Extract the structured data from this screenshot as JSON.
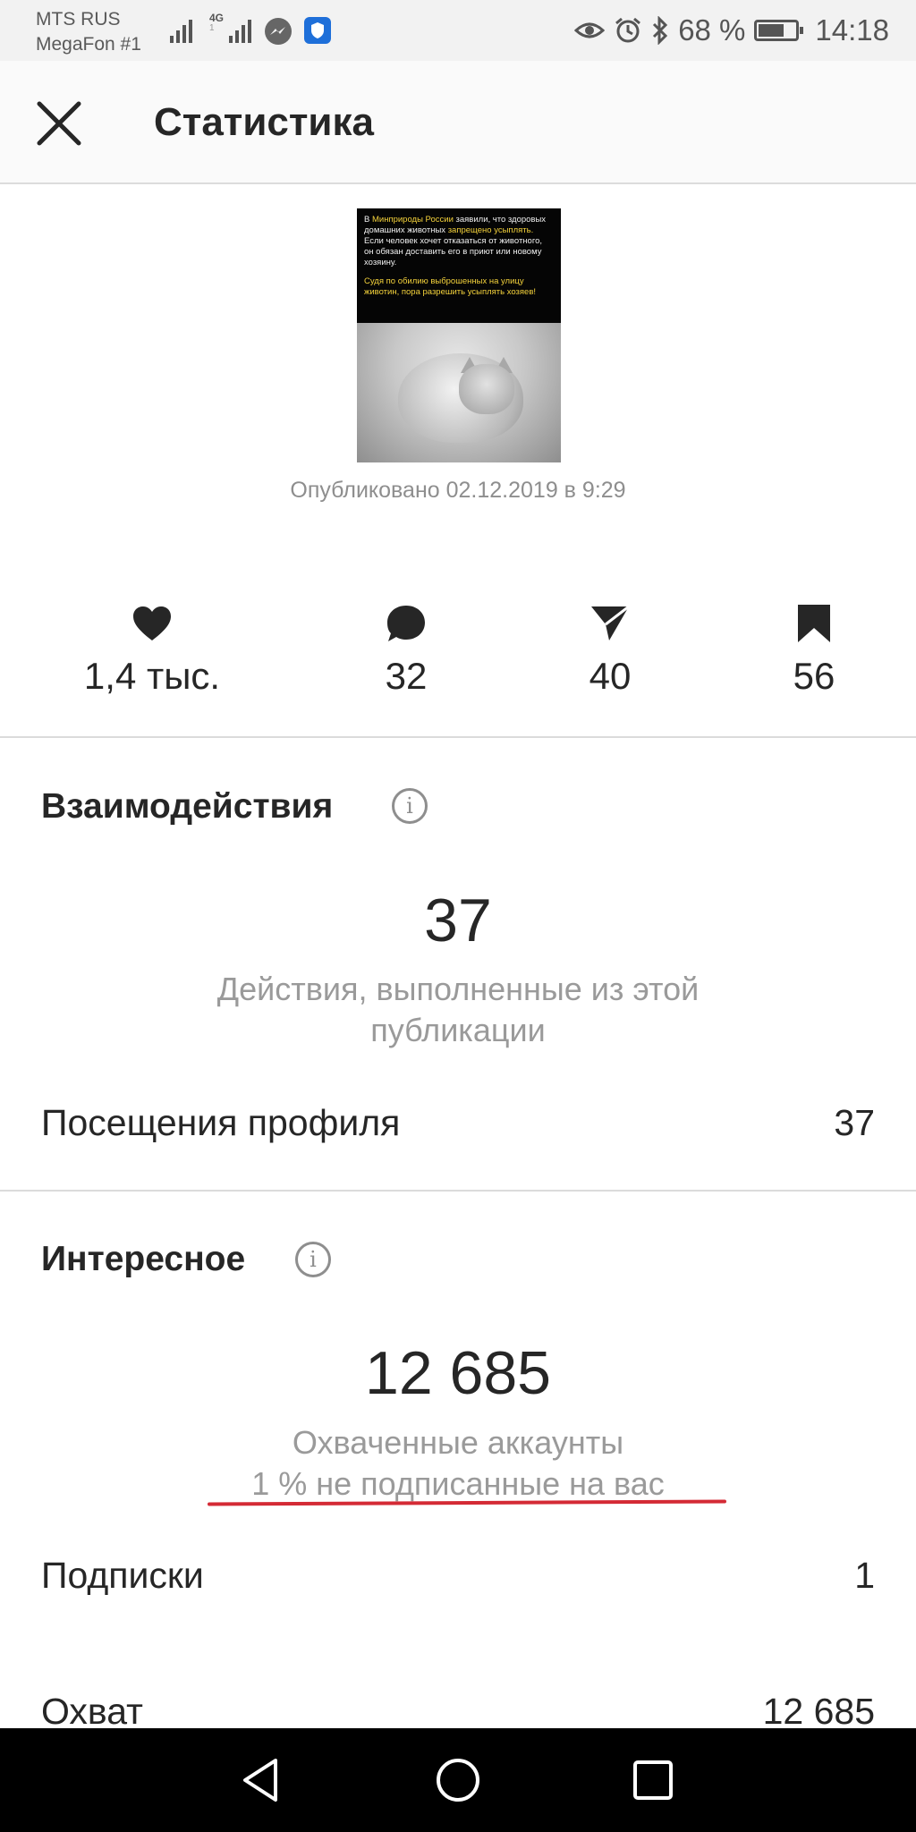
{
  "status_bar": {
    "carrier_1": "MTS RUS",
    "carrier_2": "MegaFon #1",
    "network_type": "4G",
    "network_sub": "1",
    "battery_text": "68 %",
    "battery_level": 0.68,
    "time": "14:18",
    "icons": [
      "signal-icon",
      "signal-icon",
      "messenger-icon",
      "shield-icon",
      "eye-icon",
      "alarm-icon",
      "bluetooth-icon",
      "battery-icon"
    ]
  },
  "header": {
    "close_icon": "close-icon",
    "title": "Статистика"
  },
  "post": {
    "image_caption_lines": [
      {
        "parts": [
          {
            "t": "В "
          },
          {
            "t": "Минприроды России",
            "hl": true
          },
          {
            "t": " заявили, что здоровых домашних животных "
          },
          {
            "t": "запрещено усыплять.",
            "hl": true
          },
          {
            "t": " Если человек хочет отказаться от животного, он обязан доставить его в приют или новому хозяину."
          }
        ]
      },
      {
        "parts": [
          {
            "t": "Судя по обилию выброшенных на улицу животин, пора разрешить усыплять хозяев!",
            "hl": true
          }
        ]
      }
    ],
    "published": "Опубликовано 02.12.2019 в 9:29"
  },
  "stats": [
    {
      "icon": "heart-icon",
      "value": "1,4 тыс."
    },
    {
      "icon": "comment-icon",
      "value": "32"
    },
    {
      "icon": "share-icon",
      "value": "40"
    },
    {
      "icon": "bookmark-icon",
      "value": "56"
    }
  ],
  "interactions": {
    "title": "Взаимодействия",
    "total": "37",
    "description_line1": "Действия, выполненные из этой",
    "description_line2": "публикации",
    "rows": [
      {
        "label": "Посещения профиля",
        "value": "37"
      }
    ]
  },
  "discovery": {
    "title": "Интересное",
    "total": "12 685",
    "description_line1": "Охваченные аккаунты",
    "description_line2": "1 % не подписанные на вас",
    "rows": [
      {
        "label": "Подписки",
        "value": "1"
      },
      {
        "label": "Охват",
        "value": "12 685"
      }
    ]
  },
  "colors": {
    "underline": "#d42a35",
    "text": "#262626",
    "muted": "#8e8e8e"
  },
  "nav_bar": {
    "icons": [
      "back-icon",
      "home-icon",
      "recents-icon"
    ]
  }
}
